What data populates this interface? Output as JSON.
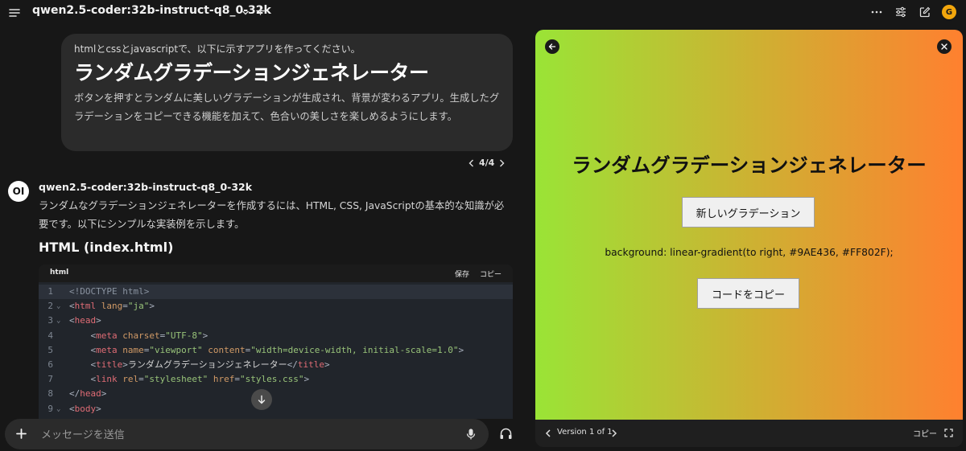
{
  "header": {
    "model_name": "qwen2.5-coder:32b-instruct-q8_0-32k",
    "avatar_initial": "G"
  },
  "user_message": {
    "line1": "htmlとcssとjavascriptで、以下に示すアプリを作ってください。",
    "title": "ランダムグラデーションジェネレーター",
    "description": "ボタンを押すとランダムに美しいグラデーションが生成され、背景が変わるアプリ。生成したグラデーションをコピーできる機能を加えて、色合いの美しさを楽しめるようにします。"
  },
  "pagination": {
    "label": "4/4"
  },
  "assistant": {
    "avatar_text": "OI",
    "model_name": "qwen2.5-coder:32b-instruct-q8_0-32k",
    "intro": "ランダムなグラデーションジェネレーターを作成するには、HTML, CSS, JavaScriptの基本的な知識が必要です。以下にシンプルな実装例を示します。",
    "heading": "HTML (index.html)"
  },
  "code_block": {
    "language": "html",
    "save_label": "保存",
    "copy_label": "コピー",
    "lines": [
      {
        "n": "1",
        "fold": "",
        "tokens": [
          [
            "doc",
            "<!DOCTYPE html>"
          ]
        ]
      },
      {
        "n": "2",
        "fold": "⌄",
        "tokens": [
          [
            "plain",
            "<"
          ],
          [
            "tag",
            "html"
          ],
          [
            "plain",
            " "
          ],
          [
            "attr",
            "lang"
          ],
          [
            "plain",
            "="
          ],
          [
            "str",
            "\"ja\""
          ],
          [
            "plain",
            ">"
          ]
        ]
      },
      {
        "n": "3",
        "fold": "⌄",
        "tokens": [
          [
            "plain",
            "<"
          ],
          [
            "tag",
            "head"
          ],
          [
            "plain",
            ">"
          ]
        ]
      },
      {
        "n": "4",
        "fold": "",
        "tokens": [
          [
            "plain",
            "    <"
          ],
          [
            "tag",
            "meta"
          ],
          [
            "plain",
            " "
          ],
          [
            "attr",
            "charset"
          ],
          [
            "plain",
            "="
          ],
          [
            "str",
            "\"UTF-8\""
          ],
          [
            "plain",
            ">"
          ]
        ]
      },
      {
        "n": "5",
        "fold": "",
        "tokens": [
          [
            "plain",
            "    <"
          ],
          [
            "tag",
            "meta"
          ],
          [
            "plain",
            " "
          ],
          [
            "attr",
            "name"
          ],
          [
            "plain",
            "="
          ],
          [
            "str",
            "\"viewport\""
          ],
          [
            "plain",
            " "
          ],
          [
            "attr",
            "content"
          ],
          [
            "plain",
            "="
          ],
          [
            "str",
            "\"width=device-width, initial-scale=1.0\""
          ],
          [
            "plain",
            ">"
          ]
        ]
      },
      {
        "n": "6",
        "fold": "",
        "tokens": [
          [
            "plain",
            "    <"
          ],
          [
            "tag",
            "title"
          ],
          [
            "plain",
            ">"
          ],
          [
            "text",
            "ランダムグラデーションジェネレーター"
          ],
          [
            "plain",
            "</"
          ],
          [
            "tag",
            "title"
          ],
          [
            "plain",
            ">"
          ]
        ]
      },
      {
        "n": "7",
        "fold": "",
        "tokens": [
          [
            "plain",
            "    <"
          ],
          [
            "tag",
            "link"
          ],
          [
            "plain",
            " "
          ],
          [
            "attr",
            "rel"
          ],
          [
            "plain",
            "="
          ],
          [
            "str",
            "\"stylesheet\""
          ],
          [
            "plain",
            " "
          ],
          [
            "attr",
            "href"
          ],
          [
            "plain",
            "="
          ],
          [
            "str",
            "\"styles.css\""
          ],
          [
            "plain",
            ">"
          ]
        ]
      },
      {
        "n": "8",
        "fold": "",
        "tokens": [
          [
            "plain",
            "</"
          ],
          [
            "tag",
            "head"
          ],
          [
            "plain",
            ">"
          ]
        ]
      },
      {
        "n": "9",
        "fold": "⌄",
        "tokens": [
          [
            "plain",
            "<"
          ],
          [
            "tag",
            "body"
          ],
          [
            "plain",
            ">"
          ]
        ]
      }
    ]
  },
  "input": {
    "placeholder": "メッセージを送信"
  },
  "preview": {
    "title": "ランダムグラデーションジェネレーター",
    "generate_button": "新しいグラデーション",
    "css_text": "background: linear-gradient(to right, #9AE436, #FF802F);",
    "copy_button": "コードをコピー",
    "gradient_start": "#9AE436",
    "gradient_end": "#FF802F"
  },
  "preview_footer": {
    "version_label": "Version 1 of 1",
    "copy_label": "コピー"
  }
}
